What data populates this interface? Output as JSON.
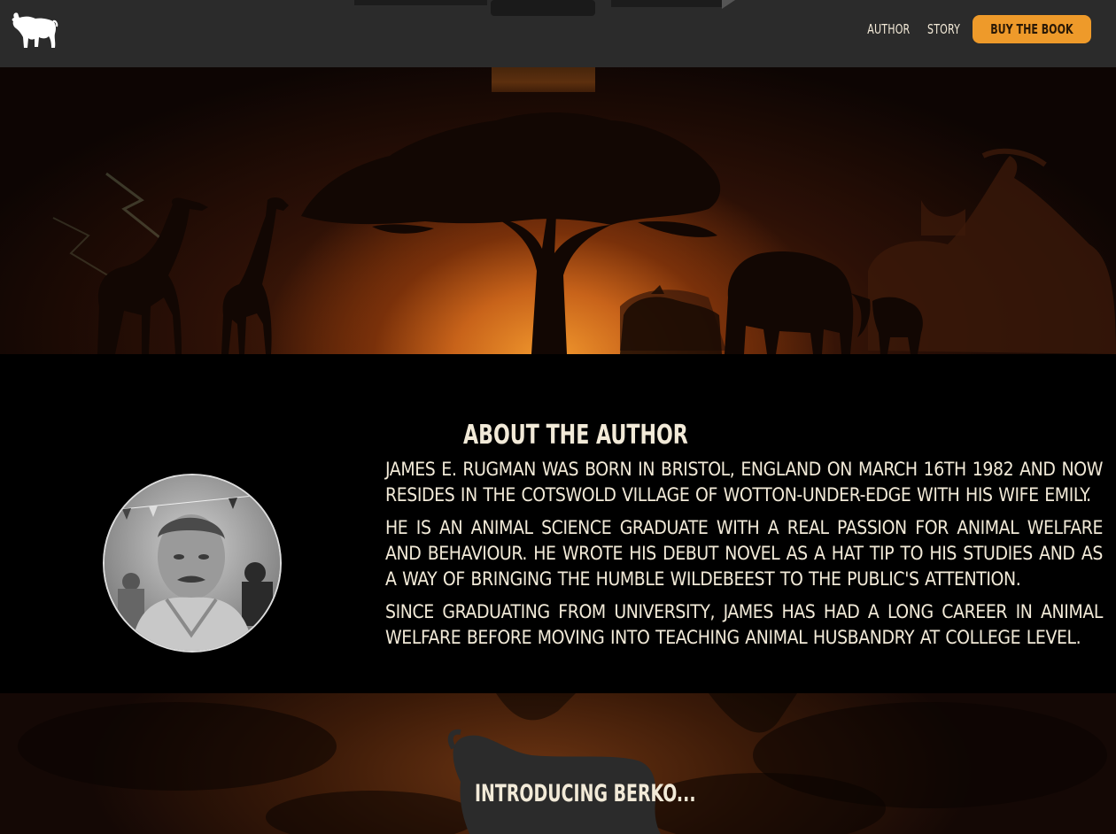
{
  "nav": {
    "logo_icon": "wildebeest-logo-icon",
    "links": [
      "Author",
      "Story"
    ],
    "buy_label": "Buy the book",
    "accent": "#ee9a2a"
  },
  "about": {
    "title": "About the author",
    "paragraphs": [
      "James E. Rugman was born in Bristol, England on March 16th 1982 and now resides in the Cotswold village of Wotton-under-Edge with his wife Emily.",
      "He is an animal science graduate with a real passion for animal welfare and behaviour. He wrote his debut novel as a hat tip to his studies and as a way of bringing the humble wildebeest to the public's attention.",
      "Since graduating from university, James has had a long career in animal welfare before moving into teaching animal husbandry at college level."
    ]
  },
  "story": {
    "title": "Introducing Berko..."
  }
}
